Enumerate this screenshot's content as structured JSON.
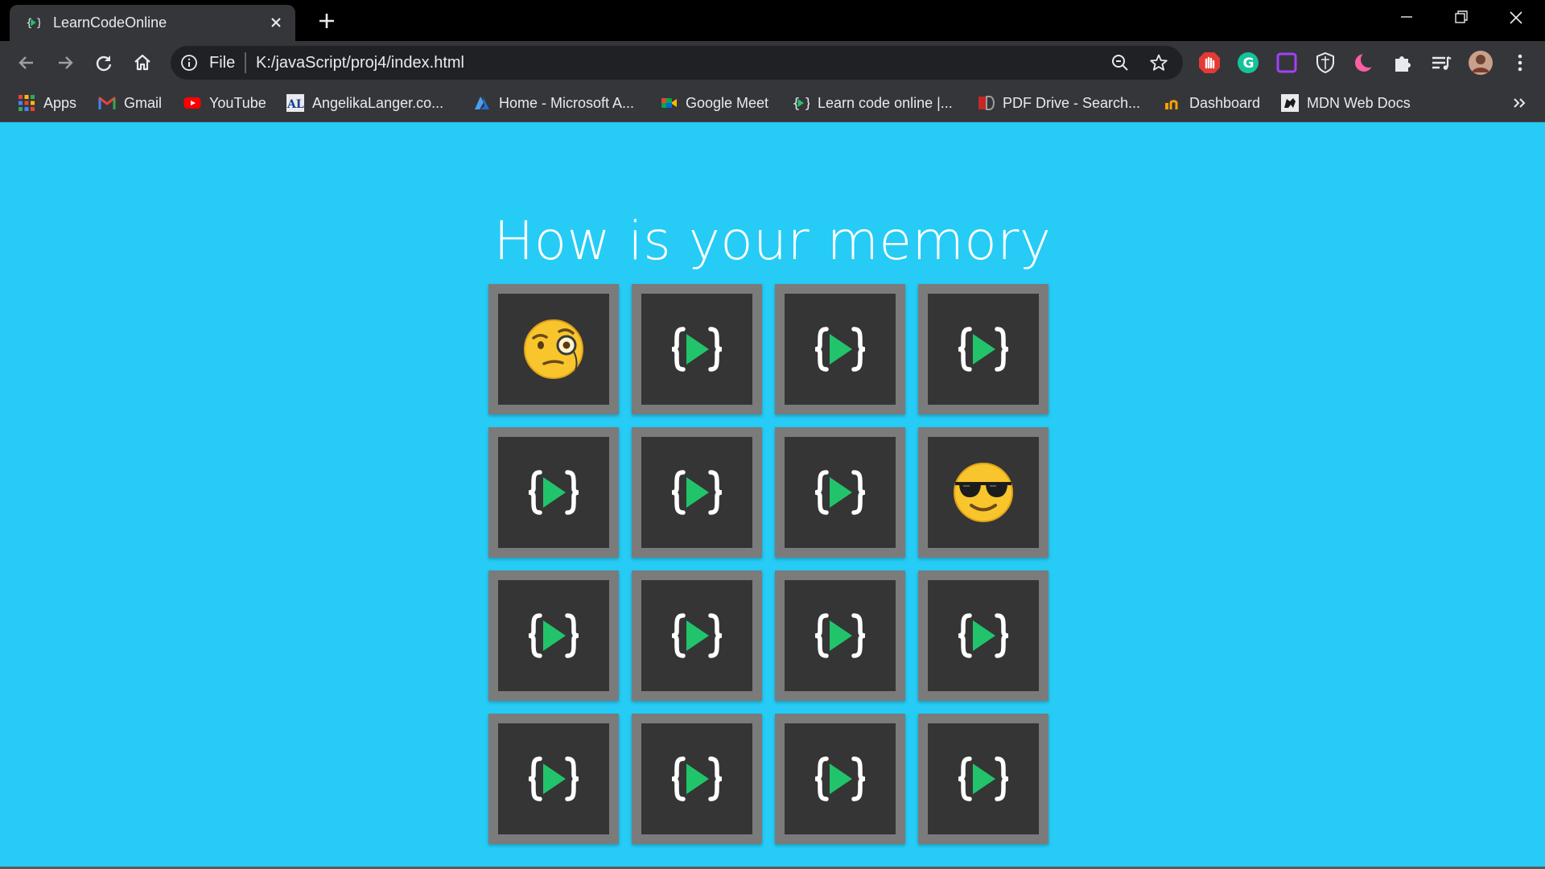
{
  "browser": {
    "tab": {
      "title": "LearnCodeOnline"
    },
    "address": {
      "scheme": "File",
      "url": "K:/javaScript/proj4/index.html"
    },
    "extensions": [
      "adblock-icon",
      "grammarly-icon",
      "screen-capture-icon",
      "shield-icon",
      "dark-reader-icon",
      "puzzle-icon",
      "reading-list-icon",
      "profile-avatar"
    ],
    "bookmarks": [
      {
        "label": "Apps",
        "icon": "apps-grid-icon"
      },
      {
        "label": "Gmail",
        "icon": "gmail-icon"
      },
      {
        "label": "YouTube",
        "icon": "youtube-icon"
      },
      {
        "label": "AngelikaLanger.co...",
        "icon": "angelikalanger-icon"
      },
      {
        "label": "Home - Microsoft A...",
        "icon": "azure-icon"
      },
      {
        "label": "Google Meet",
        "icon": "google-meet-icon"
      },
      {
        "label": "Learn code online |...",
        "icon": "learncodeonline-icon"
      },
      {
        "label": "PDF Drive - Search...",
        "icon": "pdf-drive-icon"
      },
      {
        "label": "Dashboard",
        "icon": "dashboard-icon"
      },
      {
        "label": "MDN Web Docs",
        "icon": "mdn-icon"
      }
    ]
  },
  "page": {
    "heading": "How is your memory",
    "cards": [
      {
        "face": "monocle-face"
      },
      {
        "face": "logo"
      },
      {
        "face": "logo"
      },
      {
        "face": "logo"
      },
      {
        "face": "logo"
      },
      {
        "face": "logo"
      },
      {
        "face": "logo"
      },
      {
        "face": "sunglasses-face"
      },
      {
        "face": "logo"
      },
      {
        "face": "logo"
      },
      {
        "face": "logo"
      },
      {
        "face": "logo"
      },
      {
        "face": "logo"
      },
      {
        "face": "logo"
      },
      {
        "face": "logo"
      },
      {
        "face": "logo"
      }
    ]
  },
  "colors": {
    "page_bg": "#26ccf6",
    "card_bg": "#353535",
    "card_border": "#7b7b7b",
    "logo_green": "#21c46a"
  }
}
